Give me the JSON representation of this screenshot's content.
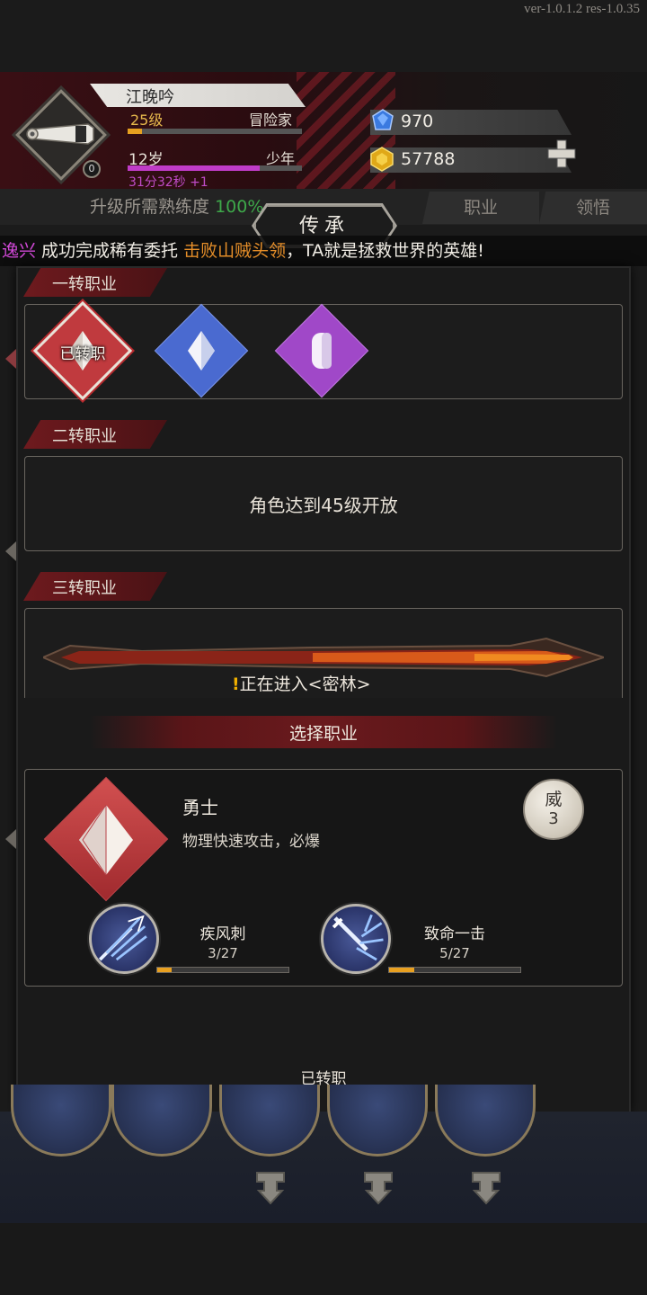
{
  "version": "ver-1.0.1.2 res-1.0.35",
  "player": {
    "name": "江晚吟",
    "level": "25级",
    "class": "冒险家",
    "level_progress": 0.08,
    "age": "12岁",
    "stage": "少年",
    "age_progress": 0.76,
    "timer": "31分32秒 +1",
    "avatar_badge": "0"
  },
  "resources": {
    "gems": "970",
    "gold": "57788"
  },
  "subheader": {
    "proficiency_label": "升级所需熟练度",
    "proficiency_pct": "100%",
    "tab_job": "职业",
    "tab_insight": "领悟"
  },
  "ticker": {
    "name": "逸兴",
    "part1": " 成功完成稀有委托 ",
    "highlight": "击败山贼头领",
    "part2": "，TA就是拯救世界的英雄!"
  },
  "inherit_tab": "传承",
  "sections": {
    "first": "一转职业",
    "second": "二转职业",
    "third": "三转职业"
  },
  "first_jobs": {
    "done_label": "已转职",
    "colors": [
      "#c03a3e",
      "#4a6ad0",
      "#a048c8"
    ]
  },
  "second_locked": "角色达到45级开放",
  "entering": {
    "bang": "!",
    "text": "正在进入<密林>"
  },
  "select_title": "选择职业",
  "job": {
    "name": "勇士",
    "desc": "物理快速攻击，必爆",
    "prestige_label": "威",
    "prestige_value": "3"
  },
  "skills": [
    {
      "name": "疾风刺",
      "count": "3/27",
      "progress": 0.11
    },
    {
      "name": "致命一击",
      "count": "5/27",
      "progress": 0.19
    }
  ],
  "converted_button": "已转职"
}
